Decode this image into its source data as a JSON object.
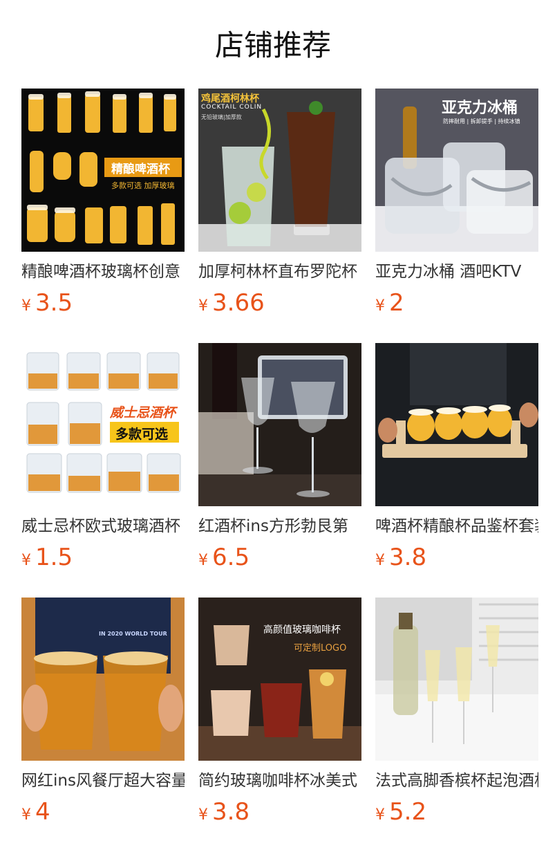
{
  "section": {
    "title": "店铺推荐"
  },
  "products": [
    {
      "name": "精酿啤酒杯玻璃杯创意",
      "currency": "¥",
      "price": "3.5",
      "img_text": {
        "badge": "精酿啤酒杯",
        "sub": "多款可选 加厚玻璃"
      }
    },
    {
      "name": "加厚柯林杯直布罗陀杯",
      "currency": "¥",
      "price": "3.66",
      "img_text": {
        "title": "鸡尾酒柯林杯",
        "en": "COCKTAIL COLIN",
        "sub": "无铅玻璃|加厚款"
      }
    },
    {
      "name": "亚克力冰桶 酒吧KTV",
      "currency": "¥",
      "price": "2",
      "img_text": {
        "title": "亚克力冰桶",
        "sub": "防摔耐用 | 拆卸提手 | 持续冰镇"
      }
    },
    {
      "name": "威士忌杯欧式玻璃酒杯",
      "currency": "¥",
      "price": "1.5",
      "img_text": {
        "title": "威士忌酒杯",
        "badge": "多款可选"
      }
    },
    {
      "name": "红酒杯ins方形勃艮第",
      "currency": "¥",
      "price": "6.5",
      "img_text": {}
    },
    {
      "name": "啤酒杯精酿杯品鉴杯套装",
      "currency": "¥",
      "price": "3.8",
      "img_text": {}
    },
    {
      "name": "网红ins风餐厅超大容量",
      "currency": "¥",
      "price": "4",
      "img_text": {
        "shirt": "IN 2020 WORLD TOUR"
      }
    },
    {
      "name": "简约玻璃咖啡杯冰美式",
      "currency": "¥",
      "price": "3.8",
      "img_text": {
        "title": "高颜值玻璃咖啡杯",
        "sub": "可定制LOGO"
      }
    },
    {
      "name": "法式高脚香槟杯起泡酒杯",
      "currency": "¥",
      "price": "5.2",
      "img_text": {}
    }
  ],
  "colors": {
    "price": "#e8531a",
    "title": "#111111"
  }
}
